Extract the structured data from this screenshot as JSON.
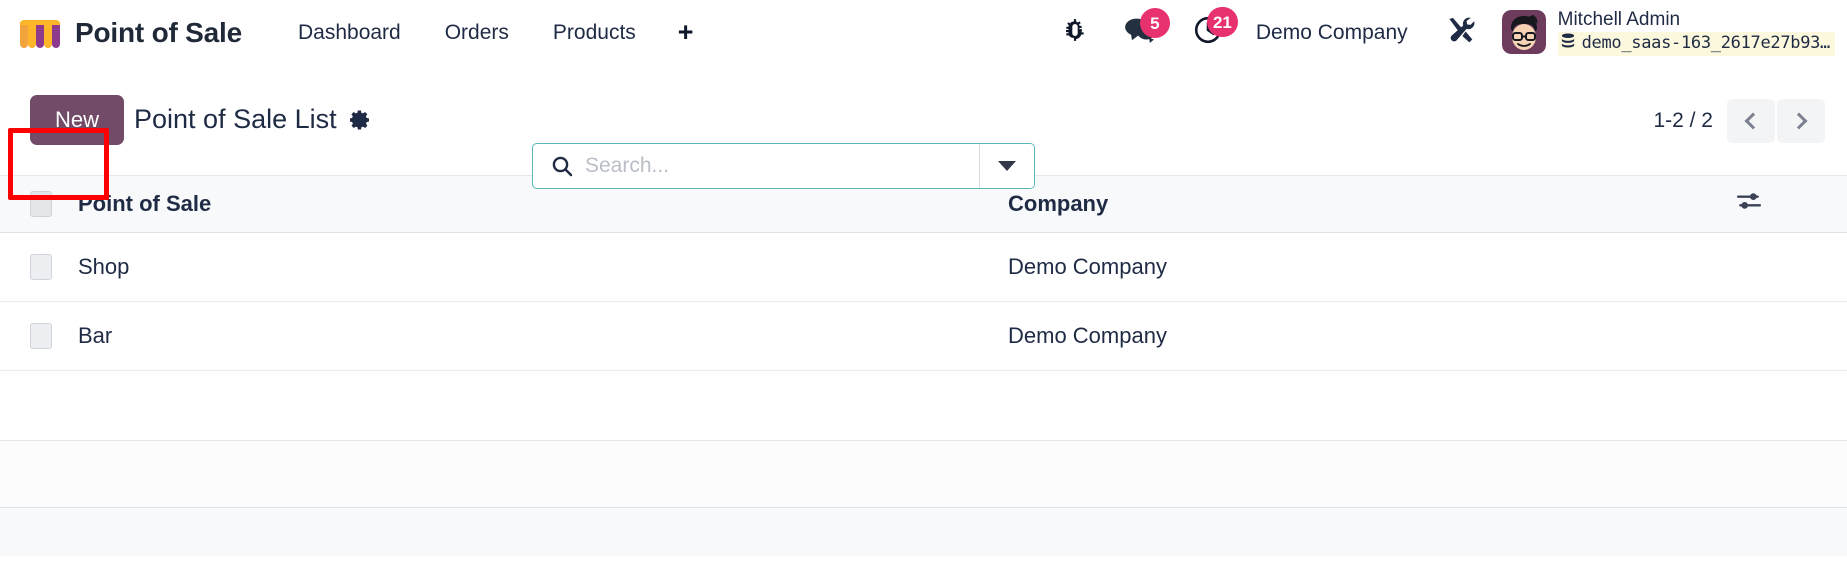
{
  "navbar": {
    "brand": {
      "label": "Point of Sale",
      "logo_icon": "pos-awning-logo"
    },
    "menu_items": [
      {
        "label": "Dashboard"
      },
      {
        "label": "Orders"
      },
      {
        "label": "Products"
      }
    ],
    "add_label": "+",
    "systray": {
      "debug_icon": "bug-icon",
      "messages": {
        "icon": "chat-bubbles-icon",
        "count": "5"
      },
      "activities": {
        "icon": "clock-icon",
        "count": "21"
      },
      "company": "Demo Company",
      "tools_icon": "tools-icon"
    },
    "user": {
      "name": "Mitchell Admin",
      "database": "demo_saas-163_2617e27b93…",
      "database_icon": "database-icon",
      "avatar_icon": "user-avatar"
    }
  },
  "control_panel": {
    "new_button": "New",
    "title": "Point of Sale List",
    "gear_icon": "gear-icon",
    "search": {
      "placeholder": "Search...",
      "value": "",
      "icon": "search-icon",
      "toggle_icon": "chevron-down-icon"
    },
    "pager": {
      "count": "1-2 / 2",
      "prev_icon": "chevron-left-icon",
      "next_icon": "chevron-right-icon"
    }
  },
  "list": {
    "columns": [
      "Point of Sale",
      "Company"
    ],
    "optional_columns_icon": "sliders-icon",
    "rows": [
      {
        "name": "Shop",
        "company": "Demo Company"
      },
      {
        "name": "Bar",
        "company": "Demo Company"
      }
    ]
  },
  "colors": {
    "accent_purple": "#714b67",
    "badge_red": "#e8326f",
    "search_border": "#5ab6b8",
    "annotation_red": "#ff0000"
  }
}
